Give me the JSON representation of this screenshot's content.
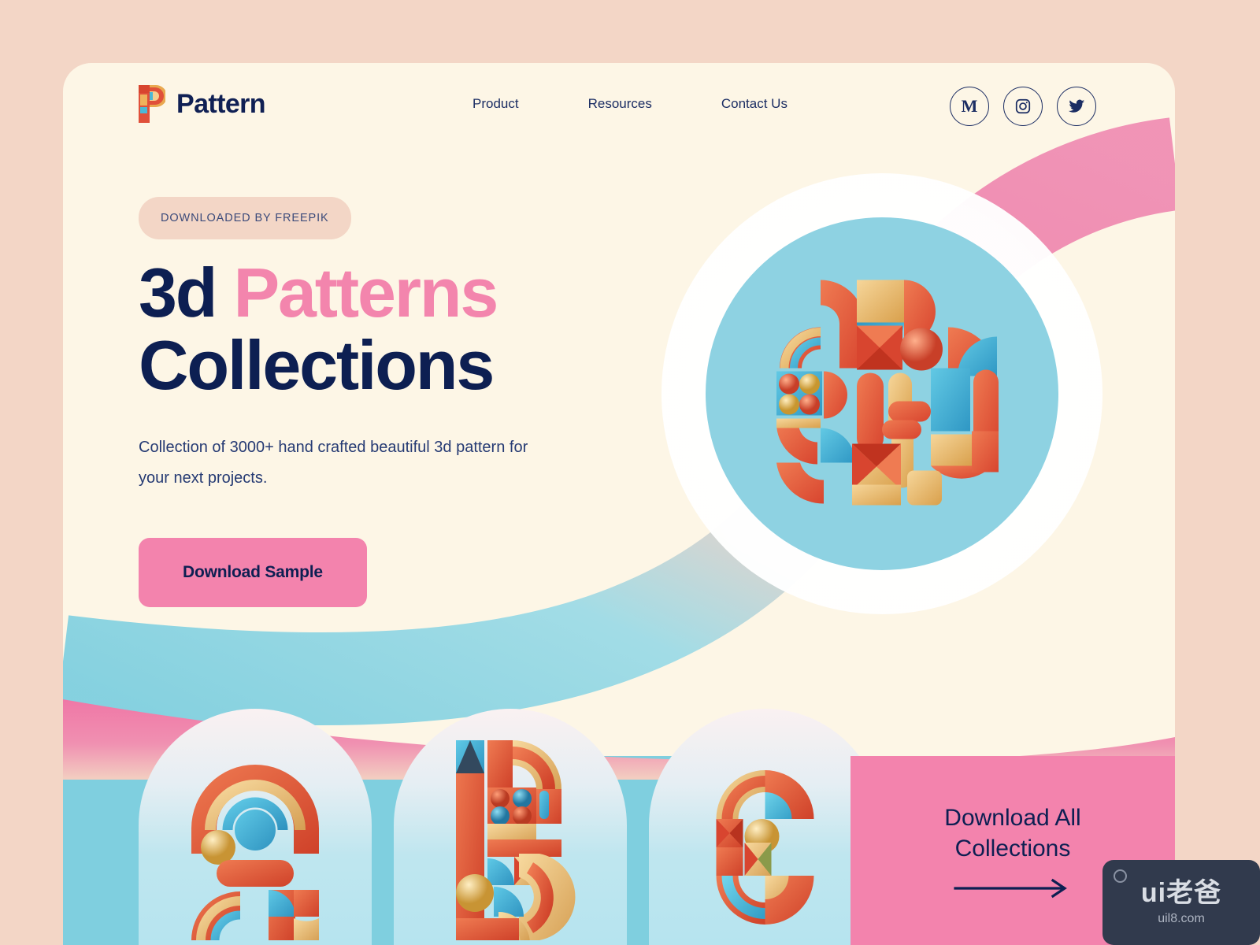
{
  "page": {
    "background_color": "#f3d6c6",
    "card_color": "#fdf6e6",
    "accent_pink": "#f383ad",
    "accent_navy": "#0d1f52",
    "accent_blue": "#7fcfdf"
  },
  "header": {
    "brand": {
      "logo_icon": "pattern-p-logo-icon",
      "name": "Pattern"
    },
    "nav": [
      {
        "label": "Product"
      },
      {
        "label": "Resources"
      },
      {
        "label": "Contact Us"
      }
    ],
    "socials": [
      {
        "icon": "medium-icon",
        "glyph": "M",
        "label": "Medium"
      },
      {
        "icon": "instagram-icon",
        "label": "Instagram"
      },
      {
        "icon": "twitter-icon",
        "label": "Twitter"
      }
    ]
  },
  "hero": {
    "badge": "DOWNLOADED BY FREEPIK",
    "headline_line1_dark": "3d",
    "headline_line1_pink": "Patterns",
    "headline_line2": "Collections",
    "subtitle": "Collection of 3000+ hand crafted beautiful 3d pattern for your next projects.",
    "cta_label": "Download Sample",
    "illustration_alt": "3d-geometric-pattern-illustration"
  },
  "showcase": {
    "cards": [
      {
        "letter": "A",
        "name": "pattern-card-a"
      },
      {
        "letter": "B",
        "name": "pattern-card-b"
      },
      {
        "letter": "C",
        "name": "pattern-card-c"
      }
    ],
    "download_all": {
      "line1": "Download All",
      "line2": "Collections",
      "arrow_icon": "arrow-right-icon"
    }
  },
  "watermark": {
    "main": "ui老爸",
    "sub": "uil8.com"
  }
}
